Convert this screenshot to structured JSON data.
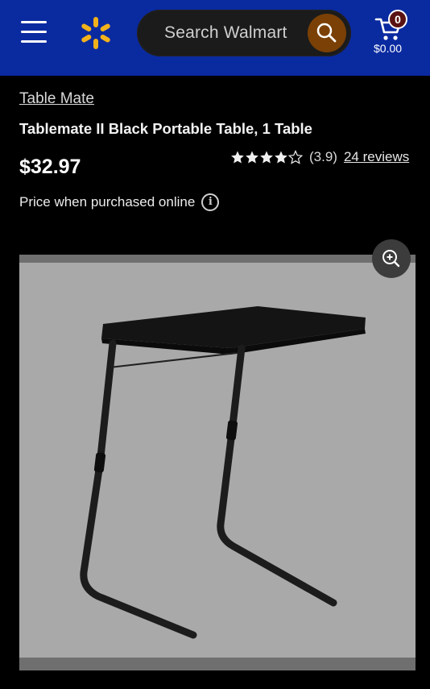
{
  "header": {
    "menu_icon": "hamburger-menu-icon",
    "logo_icon": "walmart-spark-icon",
    "search": {
      "placeholder": "Search Walmart",
      "icon": "search-icon"
    },
    "cart": {
      "icon": "cart-icon",
      "count": "0",
      "total": "$0.00"
    },
    "colors": {
      "header_bg": "#0a2aa0",
      "spark": "#f2b21b",
      "search_button": "#7a4006"
    }
  },
  "product": {
    "brand": "Table Mate",
    "title": "Tablemate II Black Portable Table, 1 Table",
    "price": "$32.97",
    "rating": {
      "stars": 3.9,
      "value_text": "(3.9)",
      "reviews_text": "24 reviews"
    },
    "price_note": "Price when purchased online",
    "info_icon_glyph": "i"
  },
  "gallery": {
    "zoom_icon": "zoom-in-icon",
    "image_description_icon": "portable-table-image"
  }
}
